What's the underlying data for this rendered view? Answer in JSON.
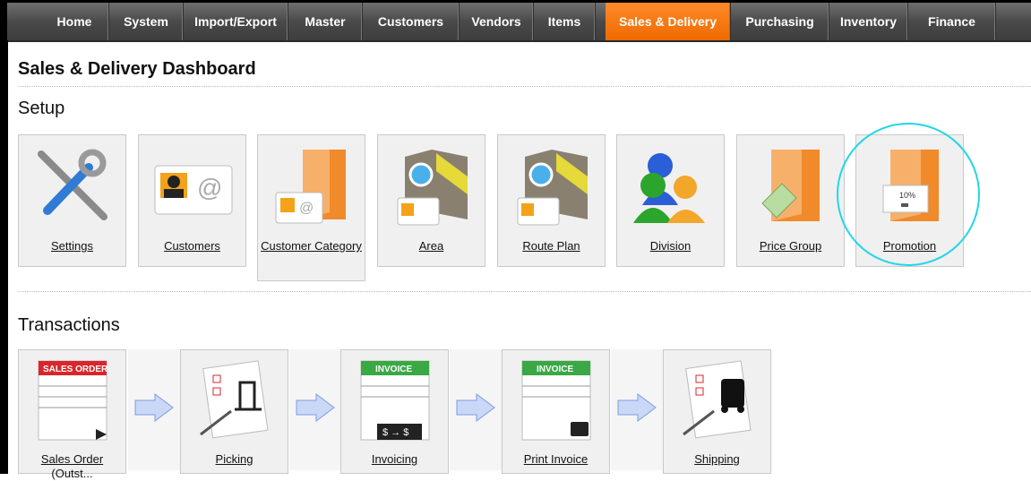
{
  "nav": {
    "items": [
      "Home",
      "System",
      "Import/Export",
      "Master",
      "Customers",
      "Vendors",
      "Items",
      "Sales & Delivery",
      "Purchasing",
      "Inventory",
      "Finance"
    ],
    "active": "Sales & Delivery"
  },
  "page": {
    "title": "Sales & Delivery Dashboard"
  },
  "setup": {
    "heading": "Setup",
    "tiles": [
      {
        "label": "Settings",
        "icon": "wrench-screwdriver-icon"
      },
      {
        "label": "Customers",
        "icon": "address-card-icon"
      },
      {
        "label": "Customer Category",
        "icon": "customer-folder-icon"
      },
      {
        "label": "Area",
        "icon": "area-map-icon"
      },
      {
        "label": "Route Plan",
        "icon": "route-map-icon"
      },
      {
        "label": "Division",
        "icon": "people-group-icon"
      },
      {
        "label": "Price Group",
        "icon": "price-tag-folder-icon"
      },
      {
        "label": "Promotion",
        "icon": "promotion-folder-icon"
      }
    ]
  },
  "transactions": {
    "heading": "Transactions",
    "tiles": [
      {
        "label": "Sales Order",
        "sublabel": "(Outst...",
        "icon": "sales-order-icon",
        "badge": "SALES ORDER"
      },
      {
        "label": "Picking",
        "icon": "forklift-checklist-icon"
      },
      {
        "label": "Invoicing",
        "icon": "invoice-icon",
        "badge": "INVOICE"
      },
      {
        "label": "Print Invoice",
        "icon": "print-invoice-icon",
        "badge": "INVOICE"
      },
      {
        "label": "Shipping",
        "icon": "truck-checklist-icon"
      }
    ]
  },
  "colors": {
    "accent": "#f07a12",
    "highlight": "#22d6e8",
    "nav": "#4a4a4a"
  }
}
